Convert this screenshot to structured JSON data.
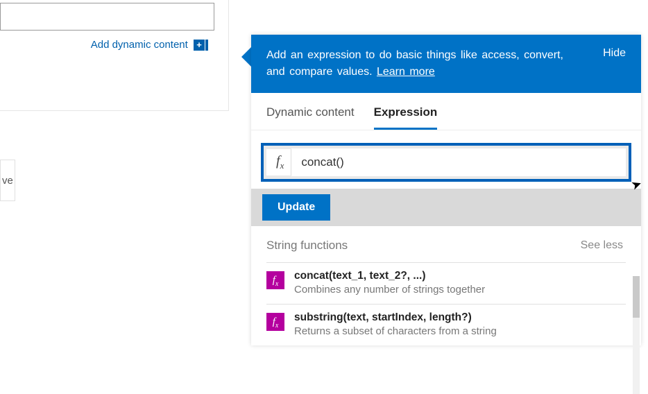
{
  "left": {
    "input_value": "",
    "add_dynamic_label": "Add dynamic content",
    "save_label_fragment": "ve"
  },
  "popup": {
    "header_text": "Add an expression to do basic things like access, convert, and compare values. ",
    "learn_more": "Learn more",
    "hide_label": "Hide",
    "tabs": {
      "dynamic": "Dynamic content",
      "expression": "Expression",
      "active": "expression"
    },
    "expression_value": "concat()",
    "update_label": "Update",
    "section": {
      "title": "String functions",
      "toggle": "See less",
      "functions": [
        {
          "signature": "concat(text_1, text_2?, ...)",
          "description": "Combines any number of strings together"
        },
        {
          "signature": "substring(text, startIndex, length?)",
          "description": "Returns a subset of characters from a string"
        }
      ]
    }
  },
  "icons": {
    "fx_label": "fx",
    "plus": "+"
  }
}
